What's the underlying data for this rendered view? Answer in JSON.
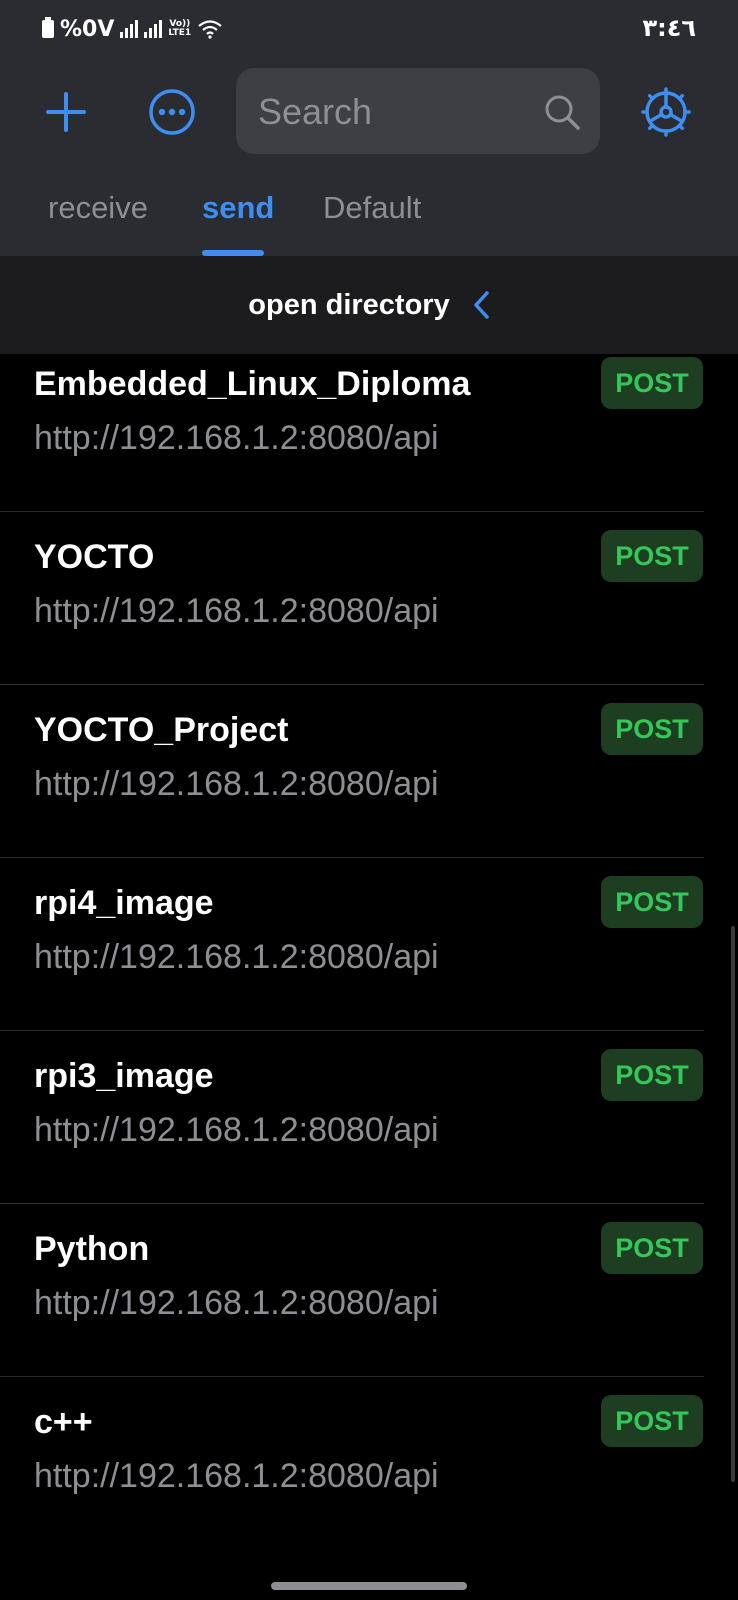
{
  "status_bar": {
    "battery": "%0V",
    "network_label_top": "Vo))",
    "network_label_bottom": "LTE1",
    "time": "٣:٤٦"
  },
  "toolbar": {
    "add_icon": "plus-icon",
    "more_icon": "ellipsis-circle-icon",
    "settings_icon": "gear-icon",
    "accent_color": "#3d8ef0"
  },
  "search": {
    "placeholder": "Search",
    "value": ""
  },
  "tabs": [
    {
      "label": "receive",
      "active": false
    },
    {
      "label": "send",
      "active": true
    },
    {
      "label": "Default",
      "active": false
    }
  ],
  "directory_bar": {
    "title": "open directory",
    "icon": "chevron-left-icon"
  },
  "requests": [
    {
      "name": "Embedded_Linux_Diploma",
      "url": "http://192.168.1.2:8080/api",
      "method": "POST"
    },
    {
      "name": "YOCTO",
      "url": "http://192.168.1.2:8080/api",
      "method": "POST"
    },
    {
      "name": "YOCTO_Project",
      "url": "http://192.168.1.2:8080/api",
      "method": "POST"
    },
    {
      "name": "rpi4_image",
      "url": "http://192.168.1.2:8080/api",
      "method": "POST"
    },
    {
      "name": "rpi3_image",
      "url": "http://192.168.1.2:8080/api",
      "method": "POST"
    },
    {
      "name": "Python",
      "url": "http://192.168.1.2:8080/api",
      "method": "POST"
    },
    {
      "name": "c++",
      "url": "http://192.168.1.2:8080/api",
      "method": "POST"
    }
  ],
  "colors": {
    "header_bg": "#2a2c31",
    "method_post_text": "#34c759",
    "method_post_bg": "#1e3e22"
  }
}
